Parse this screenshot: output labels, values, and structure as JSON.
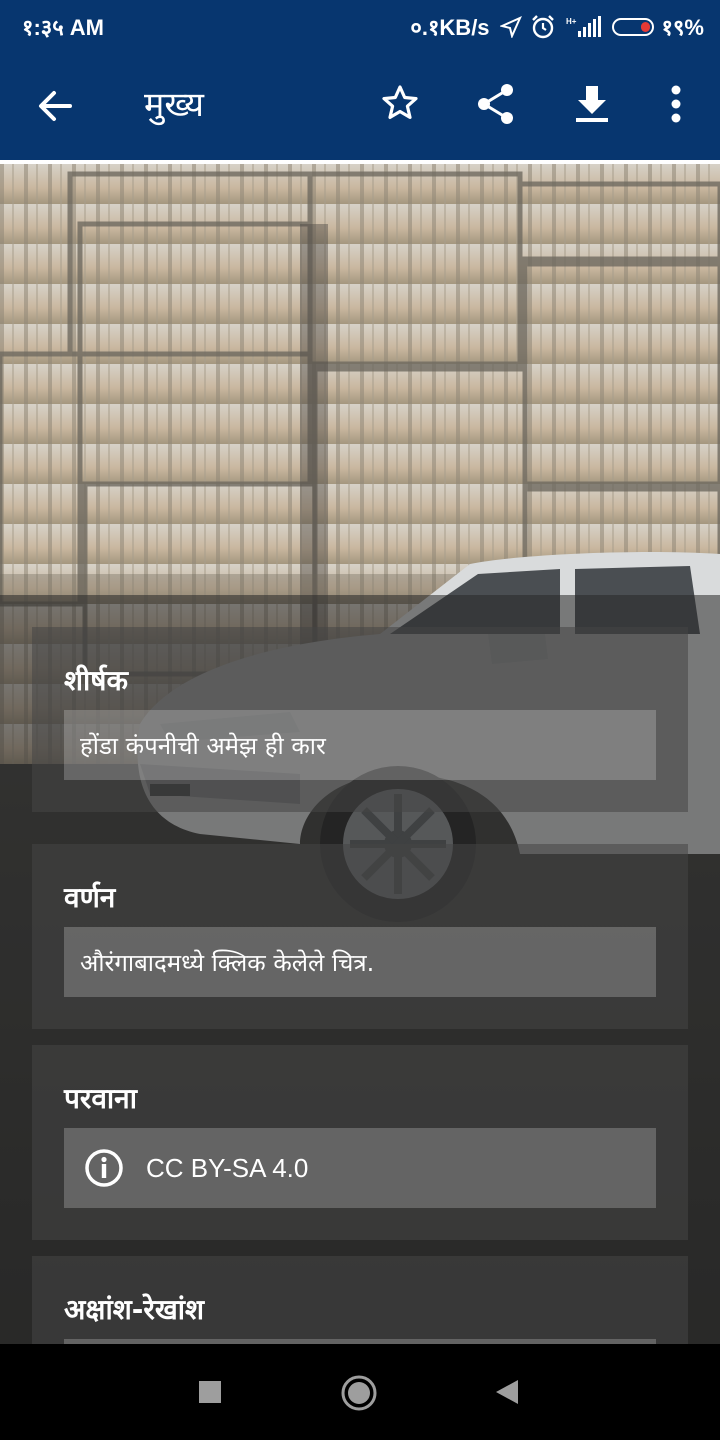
{
  "status_bar": {
    "time": "१:३५ AM",
    "network_speed": "०.१KB/s",
    "battery_percent": "१९%"
  },
  "app_bar": {
    "title": "मुख्य",
    "icons": [
      "back-arrow-icon",
      "star-icon",
      "share-icon",
      "download-icon",
      "more-vert-icon"
    ]
  },
  "details": {
    "title_label": "शीर्षक",
    "title_value": "होंडा कंपनीची अमेझ ही कार",
    "description_label": "वर्णन",
    "description_value": "औरंगाबादमध्ये क्लिक केलेले चित्र.",
    "license_label": "परवाना",
    "license_value": "CC BY-SA 4.0",
    "coordinates_label": "अक्षांश-रेखांश"
  },
  "colors": {
    "app_bar": "#07366f",
    "accent": "#ffffff"
  },
  "nav_bar": {
    "icons": [
      "recents-square-icon",
      "home-circle-icon",
      "back-triangle-icon"
    ]
  }
}
